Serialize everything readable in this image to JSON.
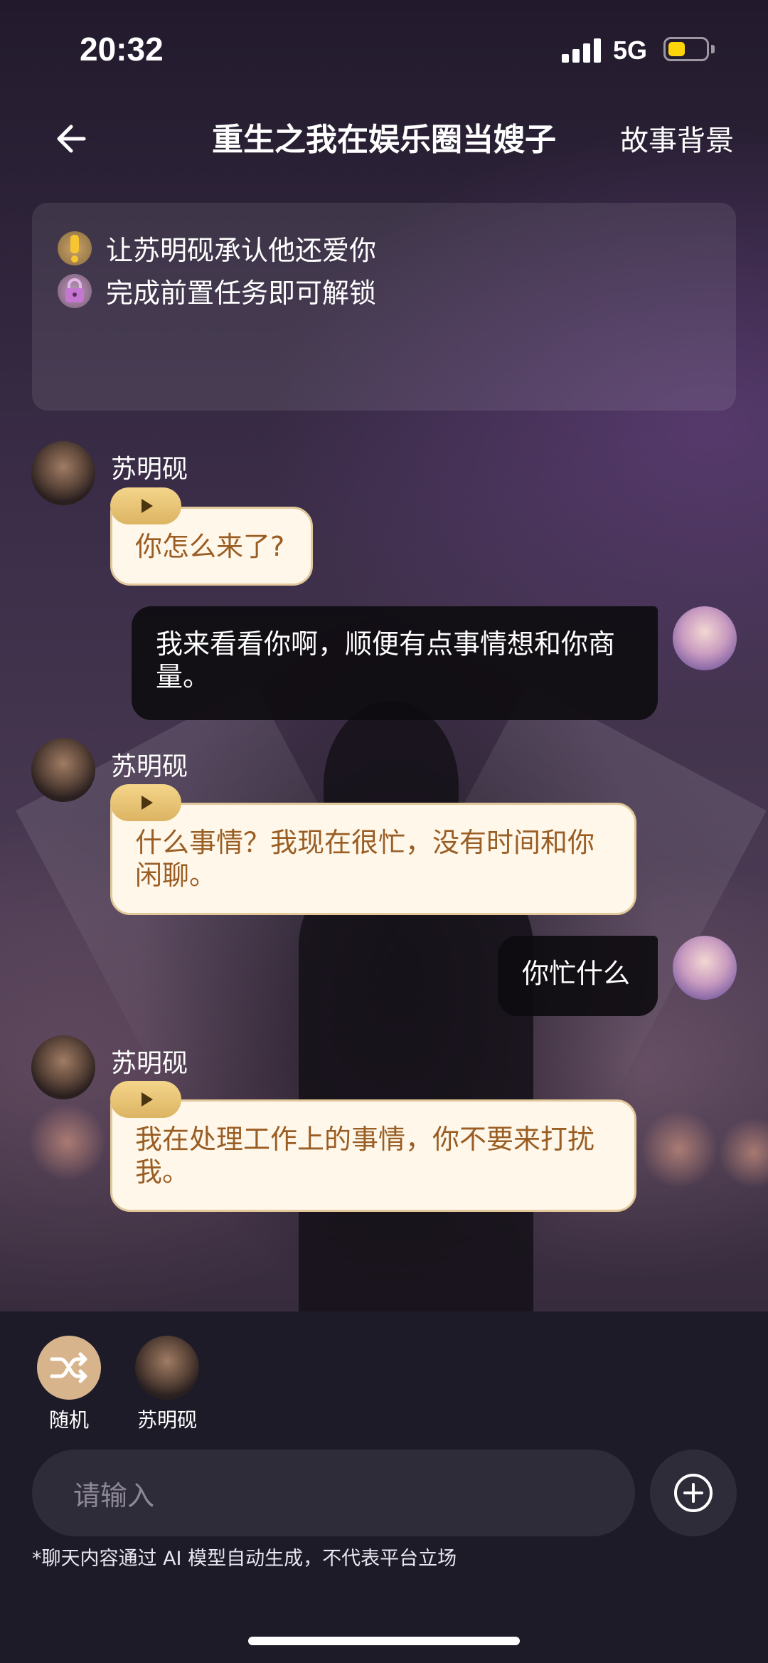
{
  "status_bar": {
    "time": "20:32",
    "network": "5G",
    "battery_level": 0.45,
    "battery_color": "#ffd40a"
  },
  "header": {
    "back_icon": "arrow-left-icon",
    "title": "重生之我在娱乐圈当嫂子",
    "story_link": "故事背景"
  },
  "tasks": [
    {
      "icon": "exclamation-icon",
      "text": "让苏明砚承认他还爱你"
    },
    {
      "icon": "lock-icon",
      "text": "完成前置任务即可解锁"
    }
  ],
  "messages": [
    {
      "sender": "npc",
      "name": "苏明砚",
      "text": "你怎么来了?"
    },
    {
      "sender": "user",
      "text": "我来看看你啊，顺便有点事情想和你商量。"
    },
    {
      "sender": "npc",
      "name": "苏明砚",
      "text": "什么事情？我现在很忙，没有时间和你闲聊。"
    },
    {
      "sender": "user",
      "text": "你忙什么"
    },
    {
      "sender": "npc",
      "name": "苏明砚",
      "text": "我在处理工作上的事情，你不要来打扰我。"
    }
  ],
  "quick_actions": [
    {
      "label": "随机",
      "icon": "shuffle-icon"
    },
    {
      "label": "苏明砚",
      "icon": "avatar"
    }
  ],
  "input": {
    "placeholder": "请输入",
    "add_icon": "plus-circle-icon"
  },
  "disclaimer": "*聊天内容通过 AI 模型自动生成，不代表平台立场",
  "colors": {
    "npc_bubble_bg": "#fff8ea",
    "npc_text": "#9a5d24",
    "voice_pill": "#f4d58a",
    "user_bubble_bg": "#0e0c10"
  }
}
